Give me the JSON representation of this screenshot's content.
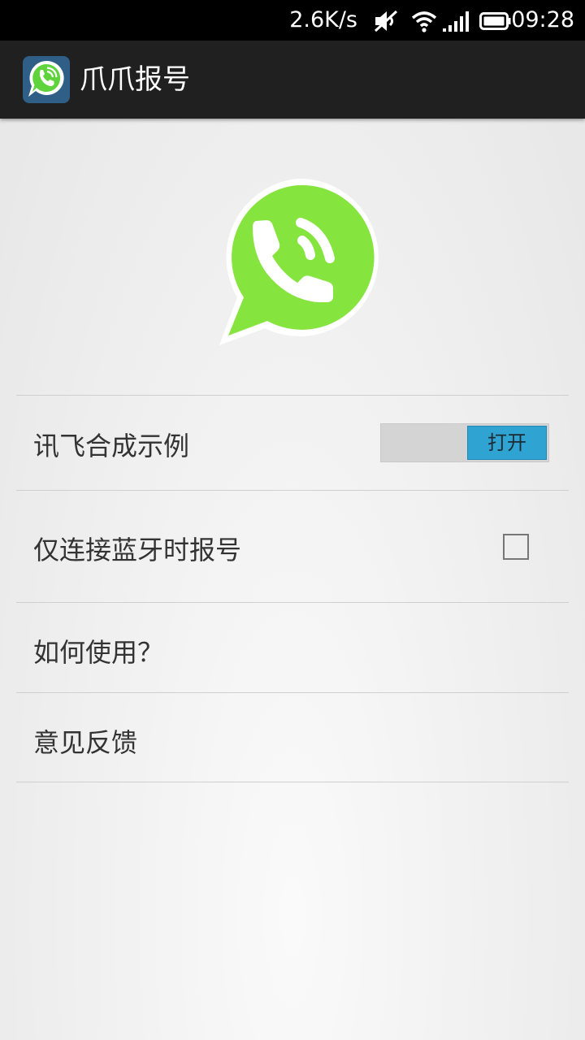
{
  "status_bar": {
    "net_speed": "2.6K/s",
    "time": "09:28",
    "icons": [
      "mute-icon",
      "wifi-icon",
      "signal-icon",
      "battery-icon"
    ]
  },
  "action_bar": {
    "title": "爪爪报号",
    "icon": "app-phone-bubble-icon"
  },
  "logo": {
    "icon": "phone-speech-bubble-icon",
    "color": "#86e43f"
  },
  "settings": {
    "items": [
      {
        "label": "讯飞合成示例",
        "control": "toggle",
        "toggle_text": "打开"
      },
      {
        "label": "仅连接蓝牙时报号",
        "control": "checkbox",
        "checked": false
      },
      {
        "label": "如何使用？"
      },
      {
        "label": "意见反馈"
      }
    ]
  },
  "colors": {
    "accent": "#2fa4d3",
    "action_bar_bg": "#202020",
    "status_bar_bg": "#000000"
  }
}
